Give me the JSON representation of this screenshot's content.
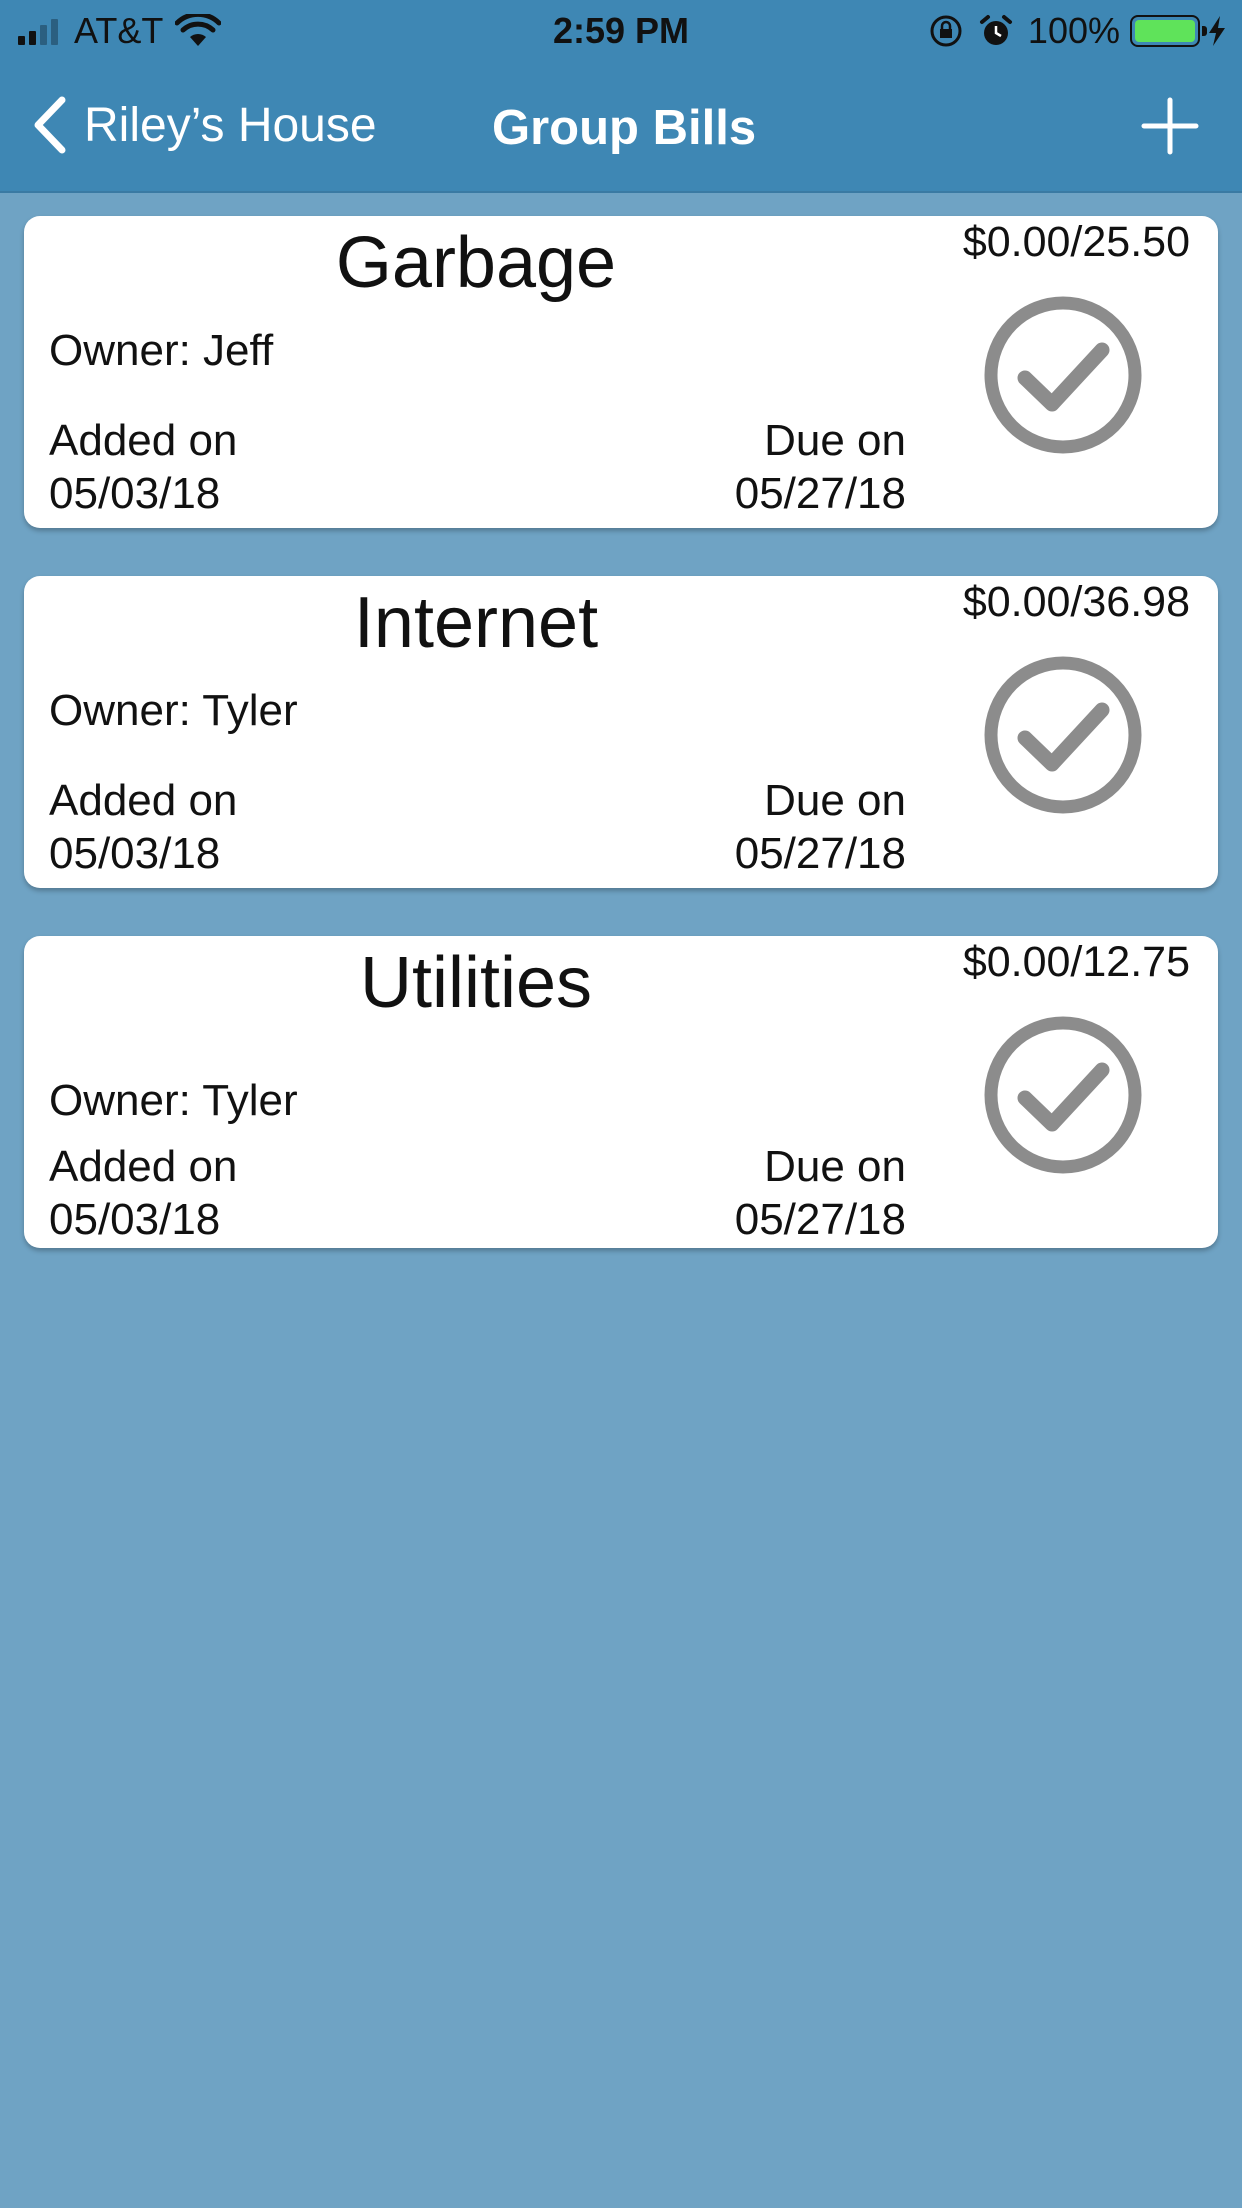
{
  "status_bar": {
    "carrier": "AT&T",
    "time": "2:59 PM",
    "battery_percent": "100%",
    "battery_level": 1.0,
    "icons": [
      "signal-icon",
      "wifi-icon",
      "orientation-lock-icon",
      "alarm-icon",
      "battery-icon",
      "charging-bolt-icon"
    ]
  },
  "navbar": {
    "back_label": "Riley’s House",
    "title": "Group Bills",
    "add_icon": "plus-icon",
    "back_icon": "chevron-left-icon"
  },
  "colors": {
    "nav_background": "#3e87b4",
    "page_background": "#6fa3c4",
    "check_color": "#8c8c8c"
  },
  "bills": [
    {
      "name": "Garbage",
      "amount": "$0.00/25.50",
      "owner": "Owner: Jeff",
      "added_label": "Added on",
      "added_date": "05/03/18",
      "due_label": "Due on",
      "due_date": "05/27/18",
      "status_icon": "check-circle-icon"
    },
    {
      "name": "Internet",
      "amount": "$0.00/36.98",
      "owner": "Owner: Tyler",
      "added_label": "Added on",
      "added_date": "05/03/18",
      "due_label": "Due on",
      "due_date": "05/27/18",
      "status_icon": "check-circle-icon"
    },
    {
      "name": "Utilities",
      "amount": "$0.00/12.75",
      "owner": "Owner: Tyler",
      "added_label": "Added on",
      "added_date": "05/03/18",
      "due_label": "Due on",
      "due_date": "05/27/18",
      "status_icon": "check-circle-icon"
    }
  ]
}
